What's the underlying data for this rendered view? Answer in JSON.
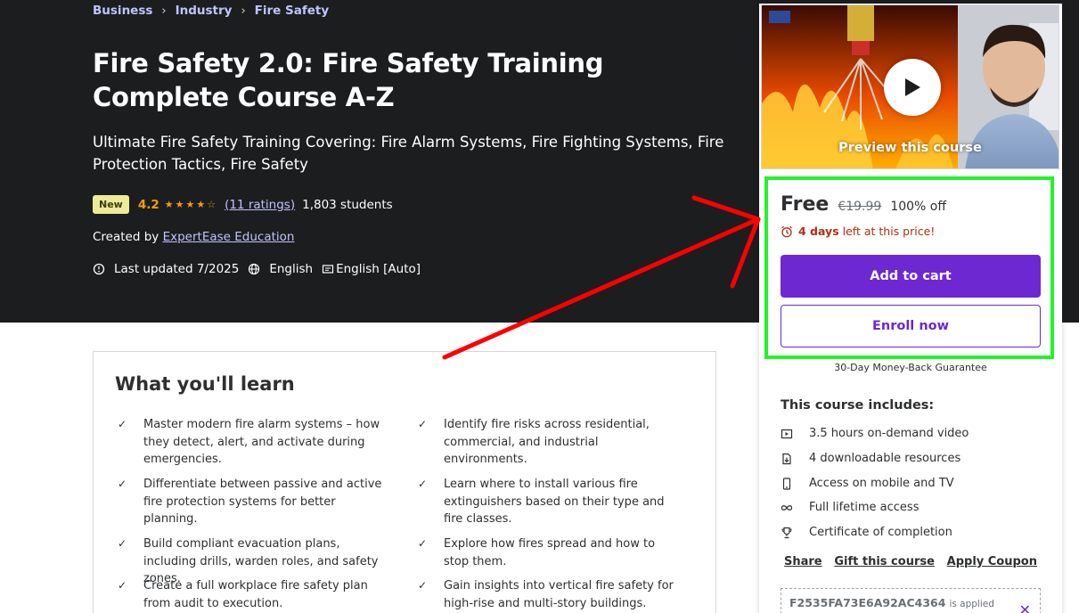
{
  "breadcrumb": [
    "Business",
    "Industry",
    "Fire Safety"
  ],
  "course": {
    "title": "Fire Safety 2.0: Fire Safety Training Complete Course A-Z",
    "subtitle": "Ultimate Fire Safety Training Covering: Fire Alarm Systems, Fire Fighting Systems, Fire Protection Tactics, Fire Safety",
    "badge": "New",
    "rating": "4.2",
    "ratings_count": "(11 ratings)",
    "students": "1,803 students",
    "created_by_label": "Created by",
    "author": "ExpertEase Education",
    "last_updated": "Last updated 7/2025",
    "language": "English",
    "captions": "English [Auto]"
  },
  "learn": {
    "title": "What you'll learn",
    "items": [
      "Master modern fire alarm systems – how they detect, alert, and activate during emergencies.",
      "Identify fire risks across residential, commercial, and industrial environments.",
      "Differentiate between passive and active fire protection systems for better planning.",
      "Learn where to install various fire extinguishers based on their type and fire classes.",
      "Build compliant evacuation plans, including drills, warden roles, and safety zones.",
      "Explore how fires spread and how to stop them.",
      "Create a full workplace fire safety plan from audit to execution.",
      "Gain insights into vertical fire safety for high-rise and multi-story buildings."
    ]
  },
  "sidebar": {
    "preview_label": "Preview this course",
    "price": "Free",
    "original_price": "€19.99",
    "discount": "100% off",
    "timer_days": "4 days",
    "timer_text": "left at this price!",
    "add_to_cart": "Add to cart",
    "enroll_now": "Enroll now",
    "guarantee": "30-Day Money-Back Guarantee",
    "includes_title": "This course includes:",
    "includes": [
      {
        "icon": "video-icon",
        "text": "3.5 hours on-demand video"
      },
      {
        "icon": "download-file-icon",
        "text": "4 downloadable resources"
      },
      {
        "icon": "mobile-icon",
        "text": "Access on mobile and TV"
      },
      {
        "icon": "infinity-icon",
        "text": "Full lifetime access"
      },
      {
        "icon": "trophy-icon",
        "text": "Certificate of completion"
      }
    ],
    "actions": [
      "Share",
      "Gift this course",
      "Apply Coupon"
    ],
    "coupon_code": "F2535FA73E6A92AC4364",
    "coupon_status": "is applied"
  },
  "colors": {
    "hero_bg": "#1c1d1f",
    "accent_purple": "#6d28d2",
    "link_lavender": "#c0c4fc",
    "star_orange": "#f69c08",
    "highlight_green": "#21f52a",
    "annotation_red": "#ff0000"
  }
}
